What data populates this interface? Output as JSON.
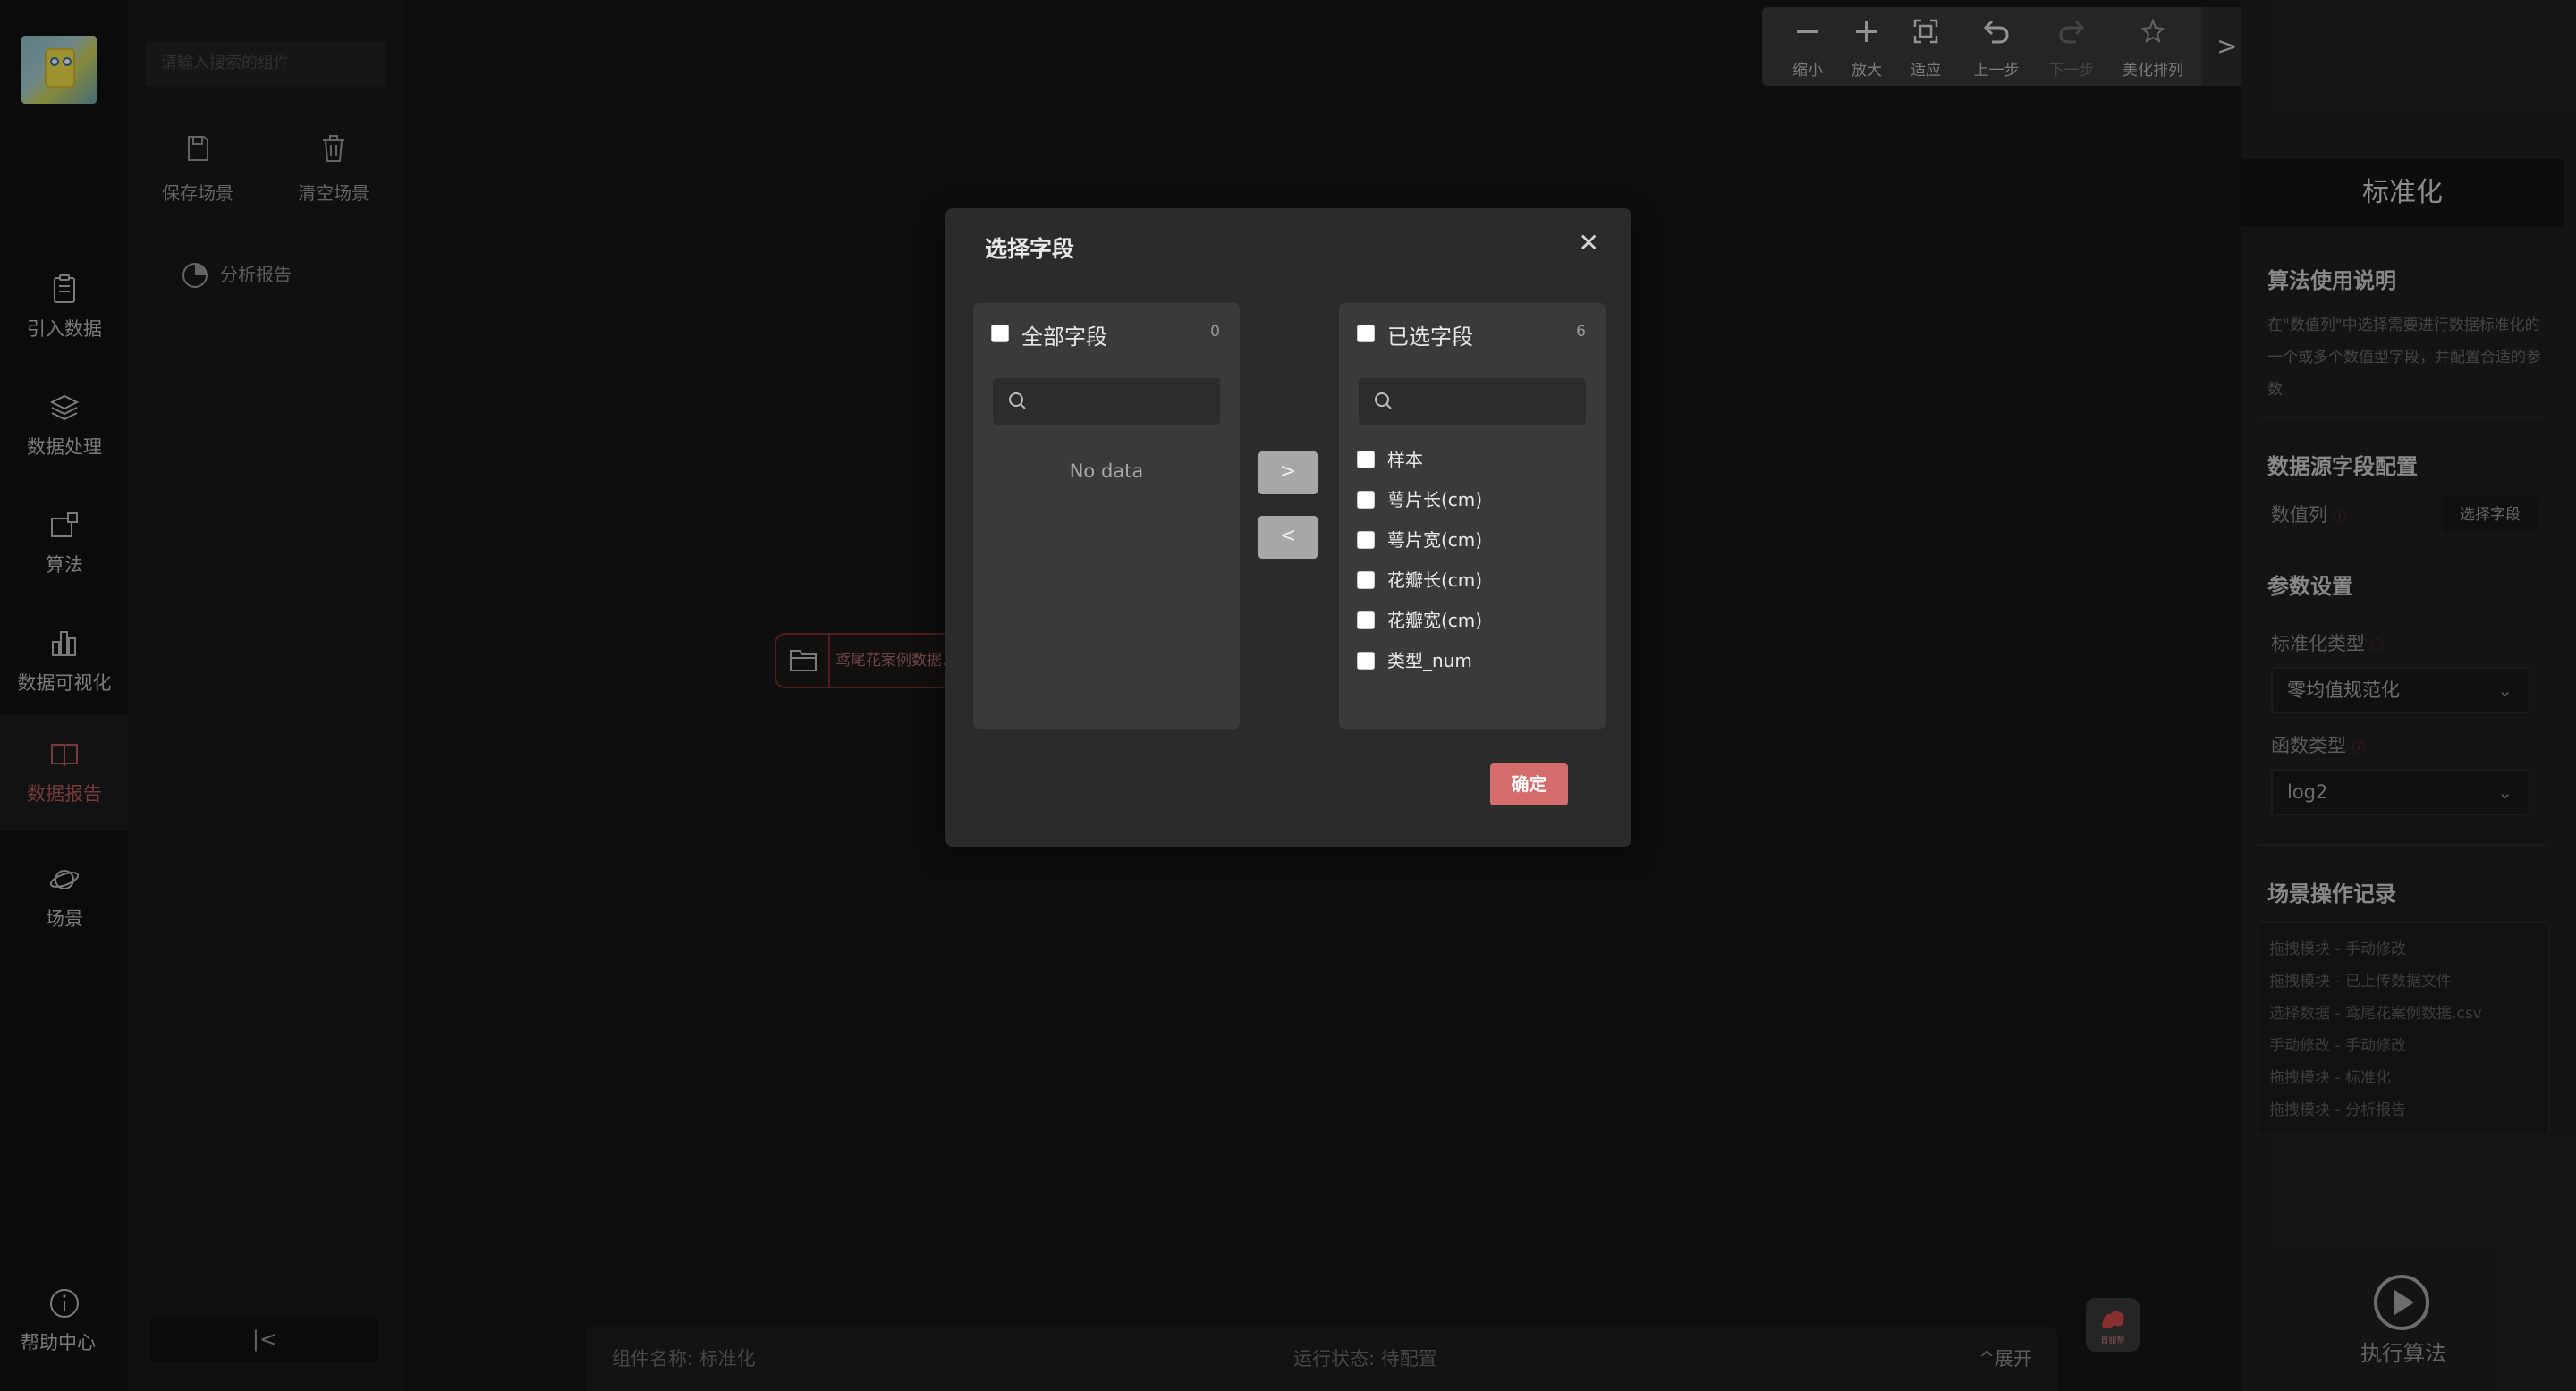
{
  "nav": {
    "items": [
      {
        "label": "引入数据"
      },
      {
        "label": "数据处理"
      },
      {
        "label": "算法"
      },
      {
        "label": "数据可视化"
      },
      {
        "label": "数据报告"
      },
      {
        "label": "场景"
      }
    ],
    "help": "帮助中心"
  },
  "panel": {
    "search_placeholder": "请输入搜索的组件",
    "save_scene": "保存场景",
    "clear_scene": "清空场景",
    "tree_item": "分析报告",
    "collapse": "|<"
  },
  "toolbar": {
    "zoom_out": "缩小",
    "zoom_in": "放大",
    "fit": "适应",
    "undo": "上一步",
    "redo": "下一步",
    "arrange": "美化排列",
    "more": ">"
  },
  "canvas": {
    "node_label": "鸢尾花案例数据...",
    "bottom": {
      "component_name": "组件名称: 标准化",
      "run_status": "运行状态: 待配置",
      "expand": "展开"
    },
    "fab_label": "首服帮"
  },
  "right": {
    "title": "标准化",
    "usage_heading": "算法使用说明",
    "usage_text": "在\"数值列\"中选择需要进行数据标准化的一个或多个数值型字段，并配置合适的参数",
    "source_heading": "数据源字段配置",
    "numeric_col_label": "数值列",
    "select_field_button": "选择字段",
    "params_heading": "参数设置",
    "std_type_label": "标准化类型",
    "std_type_value": "零均值规范化",
    "func_type_label": "函数类型",
    "func_type_value": "log2",
    "log_heading": "场景操作记录",
    "log_items": [
      "拖拽模块 - 手动修改",
      "拖拽模块 - 已上传数据文件",
      "选择数据 - 鸢尾花案例数据.csv",
      "手动修改 - 手动修改",
      "拖拽模块 - 标准化",
      "拖拽模块 - 分析报告"
    ],
    "exec_label": "执行算法"
  },
  "modal": {
    "title": "选择字段",
    "left": {
      "title": "全部字段",
      "count": "0",
      "empty": "No data"
    },
    "right": {
      "title": "已选字段",
      "count": "6",
      "items": [
        "样本",
        "萼片长(cm)",
        "萼片宽(cm)",
        "花瓣长(cm)",
        "花瓣宽(cm)",
        "类型_num"
      ]
    },
    "move_right": ">",
    "move_left": "<",
    "confirm": "确定"
  },
  "colors": {
    "accent": "#d56d6d",
    "nav_active_text": "#b55a5a"
  }
}
